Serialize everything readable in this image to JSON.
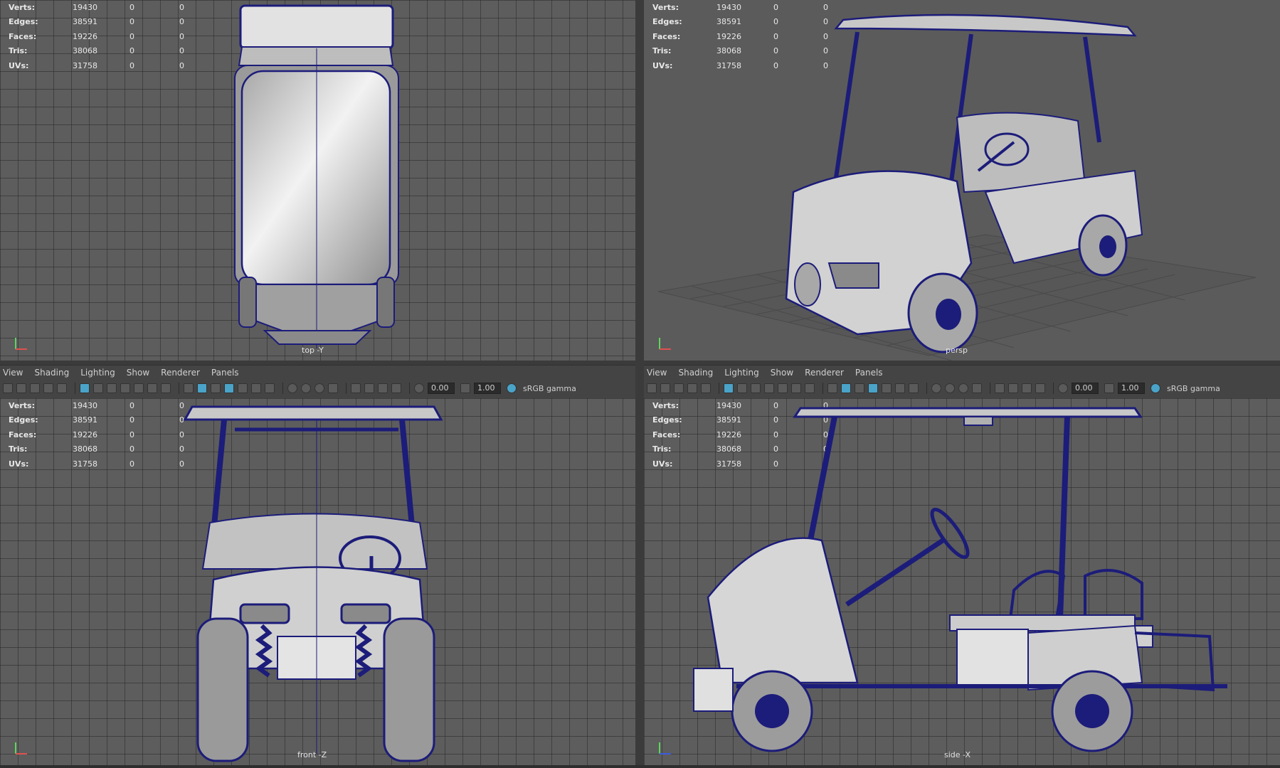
{
  "stats": {
    "rows": [
      {
        "label": "Verts:",
        "v1": "19430",
        "v2": "0",
        "v3": "0"
      },
      {
        "label": "Edges:",
        "v1": "38591",
        "v2": "0",
        "v3": "0"
      },
      {
        "label": "Faces:",
        "v1": "19226",
        "v2": "0",
        "v3": "0"
      },
      {
        "label": "Tris:",
        "v1": "38068",
        "v2": "0",
        "v3": "0"
      },
      {
        "label": "UVs:",
        "v1": "31758",
        "v2": "0",
        "v3": "0"
      }
    ]
  },
  "menus": [
    "View",
    "Shading",
    "Lighting",
    "Show",
    "Renderer",
    "Panels"
  ],
  "toolbar": {
    "exposure": "0.00",
    "gamma_value": "1.00",
    "color_space": "sRGB gamma"
  },
  "cameras": {
    "top": "top -Y",
    "persp": "persp",
    "front": "front -Z",
    "side": "side -X"
  },
  "colors": {
    "wire": "#1c1c7a",
    "shade": "#d8d8d8",
    "grid": "#5d5d5d",
    "accent": "#4aa3c8"
  }
}
